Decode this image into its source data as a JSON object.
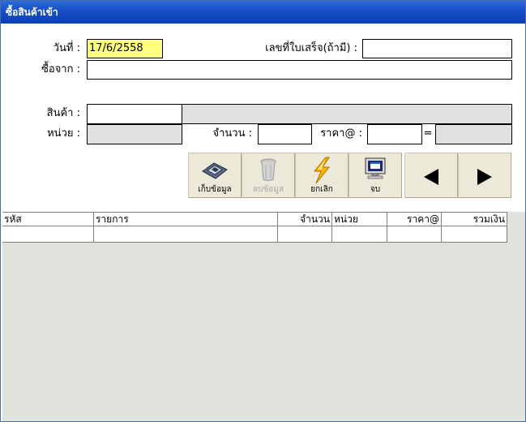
{
  "window": {
    "title": "ซื้อสินค้าเข้า"
  },
  "header": {
    "date_label": "วันที่ :",
    "date_value": "17/6/2558",
    "receipt_label": "เลขที่ใบเสร็จ(ถ้ามี) :",
    "receipt_value": "",
    "vendor_label": "ซื้อจาก :",
    "vendor_value": ""
  },
  "product": {
    "product_label": "สินค้า :",
    "product_code": "",
    "product_name": "",
    "unit_label": "หน่วย :",
    "unit_value": "",
    "qty_label": "จำนวน :",
    "qty_value": "",
    "price_label": "ราคา@ :",
    "price_value": "",
    "equals_label": "=",
    "total_value": ""
  },
  "toolbar": {
    "save_label": "เก็บข้อมูล",
    "delete_label": "ลบข้อมูล",
    "cancel_label": "ยกเลิก",
    "close_label": "จบ",
    "prev_icon": "left-triangle",
    "next_icon": "right-triangle"
  },
  "table": {
    "columns": [
      "รหัส",
      "รายการ",
      "จำนวน",
      "หน่วย",
      "ราคา@",
      "รวมเงิน"
    ],
    "rows": [
      [
        "",
        "",
        "",
        "",
        "",
        ""
      ]
    ]
  },
  "colors": {
    "title_bar": "#0a3fb3",
    "date_highlight": "#ffff7f",
    "grid_background": "#dfe3db"
  }
}
